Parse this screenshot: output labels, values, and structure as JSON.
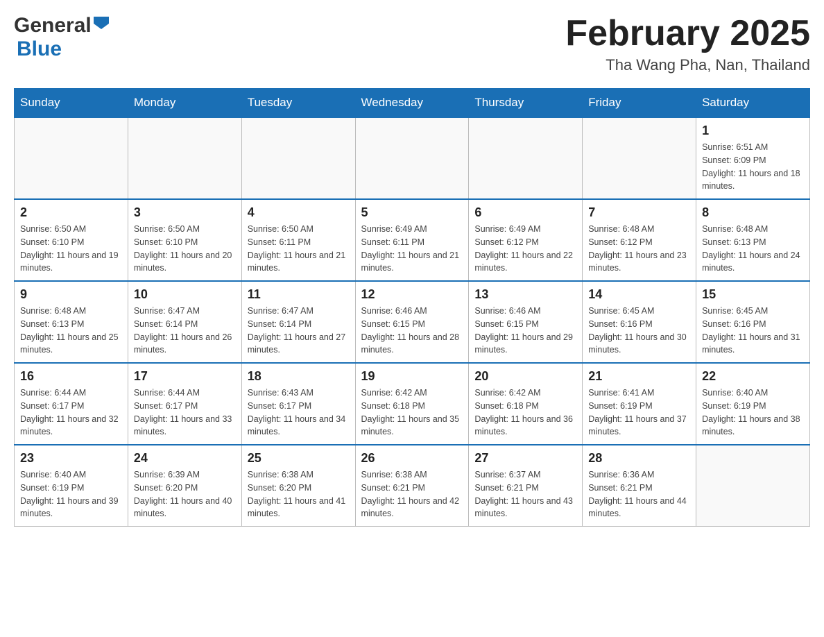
{
  "header": {
    "logo_general": "General",
    "logo_blue": "Blue",
    "month_title": "February 2025",
    "location": "Tha Wang Pha, Nan, Thailand"
  },
  "days_of_week": [
    "Sunday",
    "Monday",
    "Tuesday",
    "Wednesday",
    "Thursday",
    "Friday",
    "Saturday"
  ],
  "weeks": [
    [
      {
        "day": "",
        "info": ""
      },
      {
        "day": "",
        "info": ""
      },
      {
        "day": "",
        "info": ""
      },
      {
        "day": "",
        "info": ""
      },
      {
        "day": "",
        "info": ""
      },
      {
        "day": "",
        "info": ""
      },
      {
        "day": "1",
        "info": "Sunrise: 6:51 AM\nSunset: 6:09 PM\nDaylight: 11 hours and 18 minutes."
      }
    ],
    [
      {
        "day": "2",
        "info": "Sunrise: 6:50 AM\nSunset: 6:10 PM\nDaylight: 11 hours and 19 minutes."
      },
      {
        "day": "3",
        "info": "Sunrise: 6:50 AM\nSunset: 6:10 PM\nDaylight: 11 hours and 20 minutes."
      },
      {
        "day": "4",
        "info": "Sunrise: 6:50 AM\nSunset: 6:11 PM\nDaylight: 11 hours and 21 minutes."
      },
      {
        "day": "5",
        "info": "Sunrise: 6:49 AM\nSunset: 6:11 PM\nDaylight: 11 hours and 21 minutes."
      },
      {
        "day": "6",
        "info": "Sunrise: 6:49 AM\nSunset: 6:12 PM\nDaylight: 11 hours and 22 minutes."
      },
      {
        "day": "7",
        "info": "Sunrise: 6:48 AM\nSunset: 6:12 PM\nDaylight: 11 hours and 23 minutes."
      },
      {
        "day": "8",
        "info": "Sunrise: 6:48 AM\nSunset: 6:13 PM\nDaylight: 11 hours and 24 minutes."
      }
    ],
    [
      {
        "day": "9",
        "info": "Sunrise: 6:48 AM\nSunset: 6:13 PM\nDaylight: 11 hours and 25 minutes."
      },
      {
        "day": "10",
        "info": "Sunrise: 6:47 AM\nSunset: 6:14 PM\nDaylight: 11 hours and 26 minutes."
      },
      {
        "day": "11",
        "info": "Sunrise: 6:47 AM\nSunset: 6:14 PM\nDaylight: 11 hours and 27 minutes."
      },
      {
        "day": "12",
        "info": "Sunrise: 6:46 AM\nSunset: 6:15 PM\nDaylight: 11 hours and 28 minutes."
      },
      {
        "day": "13",
        "info": "Sunrise: 6:46 AM\nSunset: 6:15 PM\nDaylight: 11 hours and 29 minutes."
      },
      {
        "day": "14",
        "info": "Sunrise: 6:45 AM\nSunset: 6:16 PM\nDaylight: 11 hours and 30 minutes."
      },
      {
        "day": "15",
        "info": "Sunrise: 6:45 AM\nSunset: 6:16 PM\nDaylight: 11 hours and 31 minutes."
      }
    ],
    [
      {
        "day": "16",
        "info": "Sunrise: 6:44 AM\nSunset: 6:17 PM\nDaylight: 11 hours and 32 minutes."
      },
      {
        "day": "17",
        "info": "Sunrise: 6:44 AM\nSunset: 6:17 PM\nDaylight: 11 hours and 33 minutes."
      },
      {
        "day": "18",
        "info": "Sunrise: 6:43 AM\nSunset: 6:17 PM\nDaylight: 11 hours and 34 minutes."
      },
      {
        "day": "19",
        "info": "Sunrise: 6:42 AM\nSunset: 6:18 PM\nDaylight: 11 hours and 35 minutes."
      },
      {
        "day": "20",
        "info": "Sunrise: 6:42 AM\nSunset: 6:18 PM\nDaylight: 11 hours and 36 minutes."
      },
      {
        "day": "21",
        "info": "Sunrise: 6:41 AM\nSunset: 6:19 PM\nDaylight: 11 hours and 37 minutes."
      },
      {
        "day": "22",
        "info": "Sunrise: 6:40 AM\nSunset: 6:19 PM\nDaylight: 11 hours and 38 minutes."
      }
    ],
    [
      {
        "day": "23",
        "info": "Sunrise: 6:40 AM\nSunset: 6:19 PM\nDaylight: 11 hours and 39 minutes."
      },
      {
        "day": "24",
        "info": "Sunrise: 6:39 AM\nSunset: 6:20 PM\nDaylight: 11 hours and 40 minutes."
      },
      {
        "day": "25",
        "info": "Sunrise: 6:38 AM\nSunset: 6:20 PM\nDaylight: 11 hours and 41 minutes."
      },
      {
        "day": "26",
        "info": "Sunrise: 6:38 AM\nSunset: 6:21 PM\nDaylight: 11 hours and 42 minutes."
      },
      {
        "day": "27",
        "info": "Sunrise: 6:37 AM\nSunset: 6:21 PM\nDaylight: 11 hours and 43 minutes."
      },
      {
        "day": "28",
        "info": "Sunrise: 6:36 AM\nSunset: 6:21 PM\nDaylight: 11 hours and 44 minutes."
      },
      {
        "day": "",
        "info": ""
      }
    ]
  ],
  "colors": {
    "header_bg": "#1a6fb5",
    "border": "#999",
    "week_border_top": "#1a6fb5"
  }
}
